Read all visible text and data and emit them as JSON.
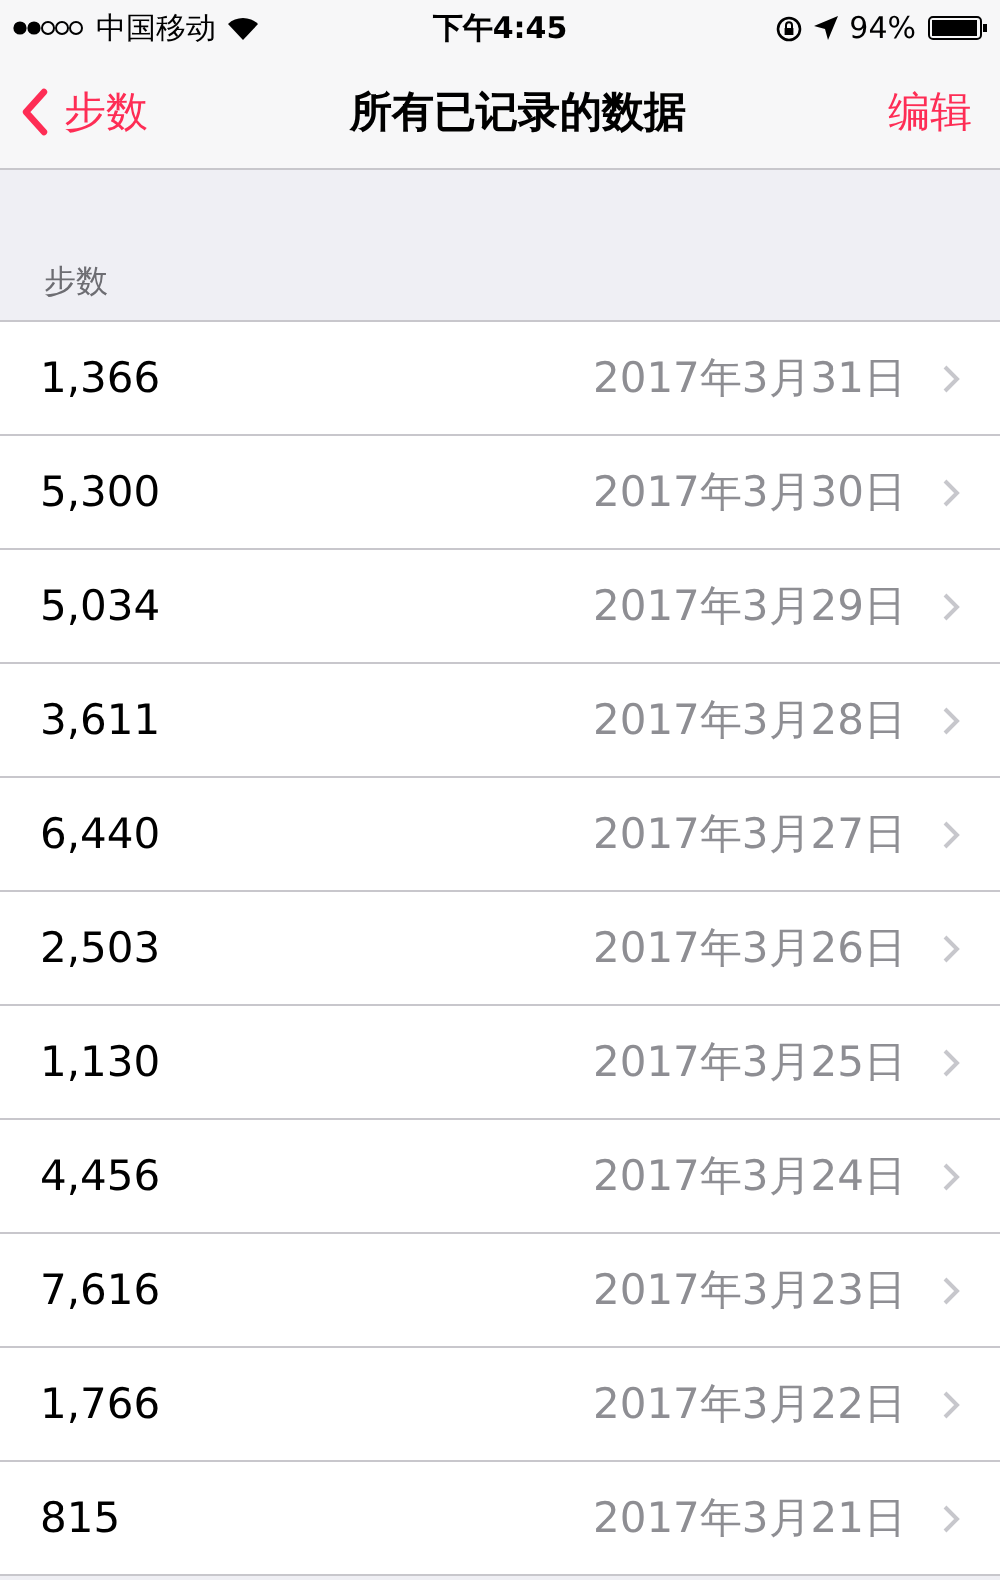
{
  "status_bar": {
    "carrier": "中国移动",
    "time": "下午4:45",
    "battery": "94%"
  },
  "nav": {
    "back": "步数",
    "title": "所有已记录的数据",
    "action": "编辑"
  },
  "section": {
    "header": "步数"
  },
  "rows": [
    {
      "value": "1,366",
      "date": "2017年3月31日"
    },
    {
      "value": "5,300",
      "date": "2017年3月30日"
    },
    {
      "value": "5,034",
      "date": "2017年3月29日"
    },
    {
      "value": "3,611",
      "date": "2017年3月28日"
    },
    {
      "value": "6,440",
      "date": "2017年3月27日"
    },
    {
      "value": "2,503",
      "date": "2017年3月26日"
    },
    {
      "value": "1,130",
      "date": "2017年3月25日"
    },
    {
      "value": "4,456",
      "date": "2017年3月24日"
    },
    {
      "value": "7,616",
      "date": "2017年3月23日"
    },
    {
      "value": "1,766",
      "date": "2017年3月22日"
    },
    {
      "value": "815",
      "date": "2017年3月21日"
    }
  ]
}
